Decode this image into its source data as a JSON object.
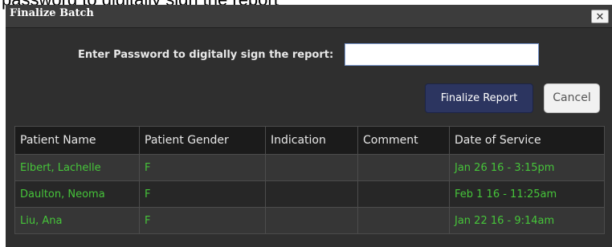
{
  "background": {
    "partial_text": "password to digitally sign the report"
  },
  "dialog": {
    "title": "Finalize Batch",
    "close_glyph": "✕",
    "password_label": "Enter Password to digitally sign the report:",
    "password_value": "",
    "finalize_label": "Finalize Report",
    "cancel_label": "Cancel"
  },
  "table": {
    "headers": [
      "Patient Name",
      "Patient Gender",
      "Indication",
      "Comment",
      "Date of Service"
    ],
    "rows": [
      {
        "name": "Elbert, Lachelle",
        "gender": "F",
        "indication": "",
        "comment": "",
        "date": "Jan 26 16 - 3:15pm"
      },
      {
        "name": "Daulton, Neoma",
        "gender": "F",
        "indication": "",
        "comment": "",
        "date": "Feb 1 16 - 11:25am"
      },
      {
        "name": "Liu, Ana",
        "gender": "F",
        "indication": "",
        "comment": "",
        "date": "Jan 22 16 - 9:14am"
      }
    ]
  },
  "colors": {
    "dialog_bg": "#2f2f2f",
    "header_bg": "#1b1b1b",
    "row_text": "#46c53a",
    "finalize_bg": "#2c3560",
    "input_border": "#7c9ad0"
  },
  "icons": {
    "close": "close-icon"
  }
}
